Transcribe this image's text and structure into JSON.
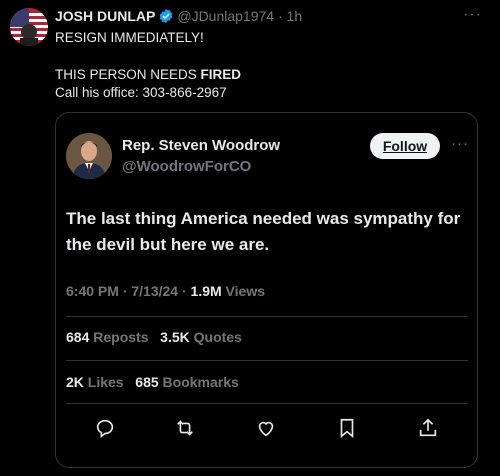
{
  "post": {
    "author_name": "JOSH DUNLAP",
    "handle": "@JDunlap1974",
    "separator": "·",
    "time": "1h",
    "more": "···",
    "line1": "RESIGN IMMEDIATELY!",
    "line2_prefix": "THIS PERSON NEEDS ",
    "line2_bold": "FIRED",
    "line3": "Call his office: 303-866-2967"
  },
  "quote": {
    "name": "Rep. Steven Woodrow",
    "handle": "@WoodrowForCO",
    "follow_label": "Follow",
    "more": "···",
    "text": "The last thing America needed was sympathy for the devil but here we are.",
    "time": "6:40 PM",
    "date": "7/13/24",
    "dot": "·",
    "views_count": "1.9M",
    "views_label": " Views",
    "reposts_count": "684",
    "reposts_label": " Reposts",
    "quotes_count": "3.5K",
    "quotes_label": " Quotes",
    "likes_count": "2K",
    "likes_label": " Likes",
    "bookmarks_count": "685",
    "bookmarks_label": " Bookmarks"
  },
  "icons": {
    "verified": "verified-badge-icon",
    "reply": "reply-icon",
    "repost": "repost-icon",
    "like": "like-icon",
    "bookmark": "bookmark-icon",
    "share": "share-icon"
  },
  "colors": {
    "background": "#000000",
    "text": "#e7e9ea",
    "muted": "#71767b",
    "border": "#2f3336",
    "verified": "#1d9bf0"
  }
}
